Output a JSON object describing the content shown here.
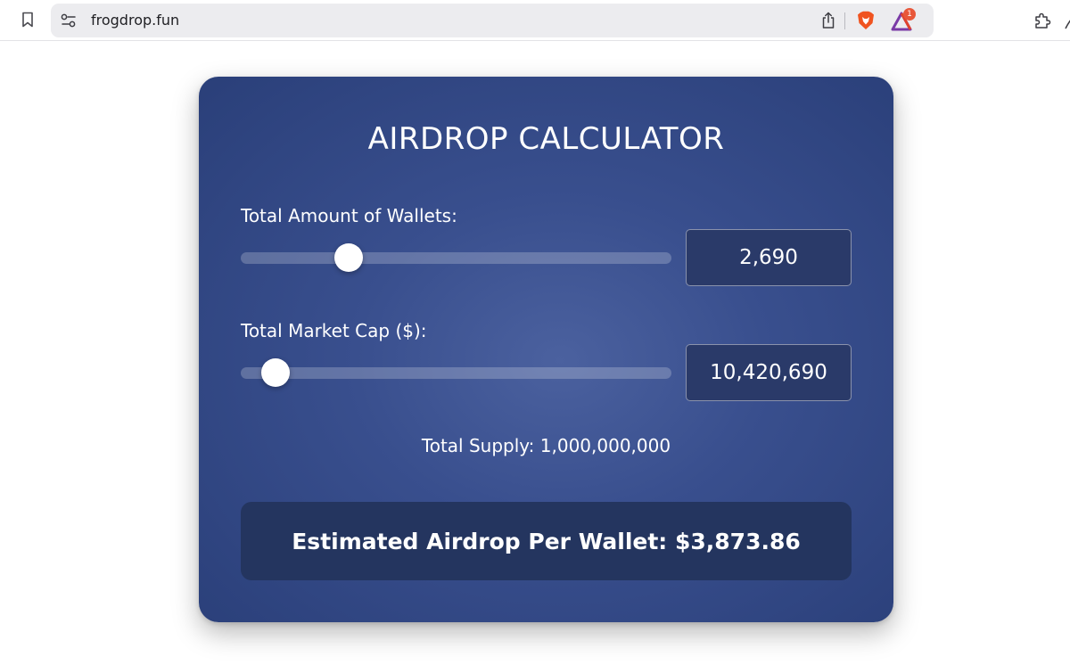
{
  "browser": {
    "url": "frogdrop.fun",
    "rewards_badge_count": "1",
    "icons": [
      "bookmark-icon",
      "site-settings-icon",
      "share-icon",
      "brave-shield-icon",
      "brave-rewards-icon",
      "extensions-icon"
    ]
  },
  "calculator": {
    "title": "AIRDROP CALCULATOR",
    "wallets": {
      "label": "Total Amount of Wallets:",
      "value": "2,690",
      "slider_fraction": 0.25
    },
    "market_cap": {
      "label": "Total Market Cap ($):",
      "value": "10,420,690",
      "slider_fraction": 0.08
    },
    "supply_text": "Total Supply: 1,000,000,000",
    "result_text": "Estimated Airdrop Per Wallet: $3,873.86"
  },
  "colors": {
    "card_background": "#394f8e",
    "result_background": "#24355f",
    "text": "#ffffff",
    "rewards_badge": "#e8573a"
  }
}
